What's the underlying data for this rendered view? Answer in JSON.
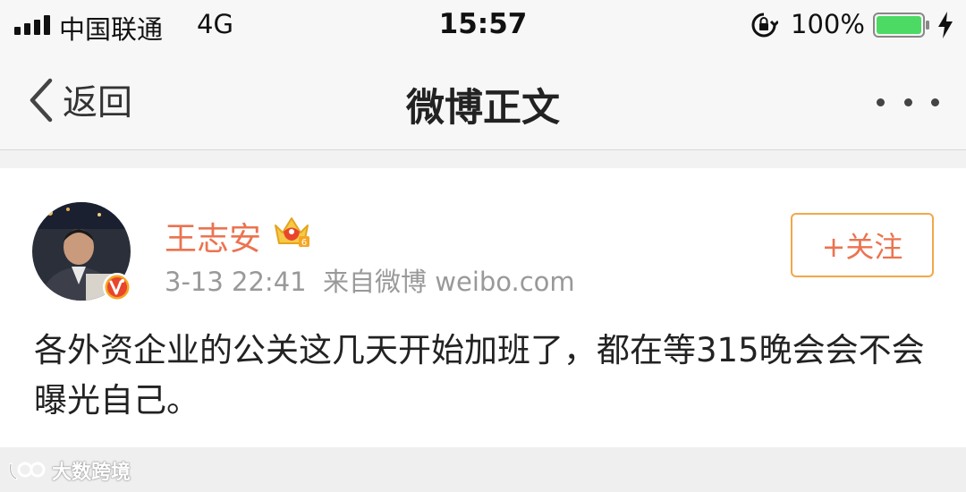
{
  "status_bar": {
    "carrier": "中国联通",
    "network": "4G",
    "time": "15:57",
    "battery_percent": "100%",
    "icons": [
      "signal-icon",
      "orientation-lock-icon",
      "battery-icon",
      "charging-bolt-icon"
    ]
  },
  "nav": {
    "back_label": "返回",
    "title": "微博正文",
    "more_icon": "more-dots-icon"
  },
  "post": {
    "author": "王志安",
    "timestamp": "3-13 22:41",
    "source": "来自微博 weibo.com",
    "follow_label": "+关注",
    "text": "各外资企业的公关这几天开始加班了，都在等315晚会会不会曝光自己。",
    "accent_color": "#eb7350",
    "verified_badge_color": "#f5a623"
  },
  "watermark": {
    "text": "大数跨境"
  }
}
